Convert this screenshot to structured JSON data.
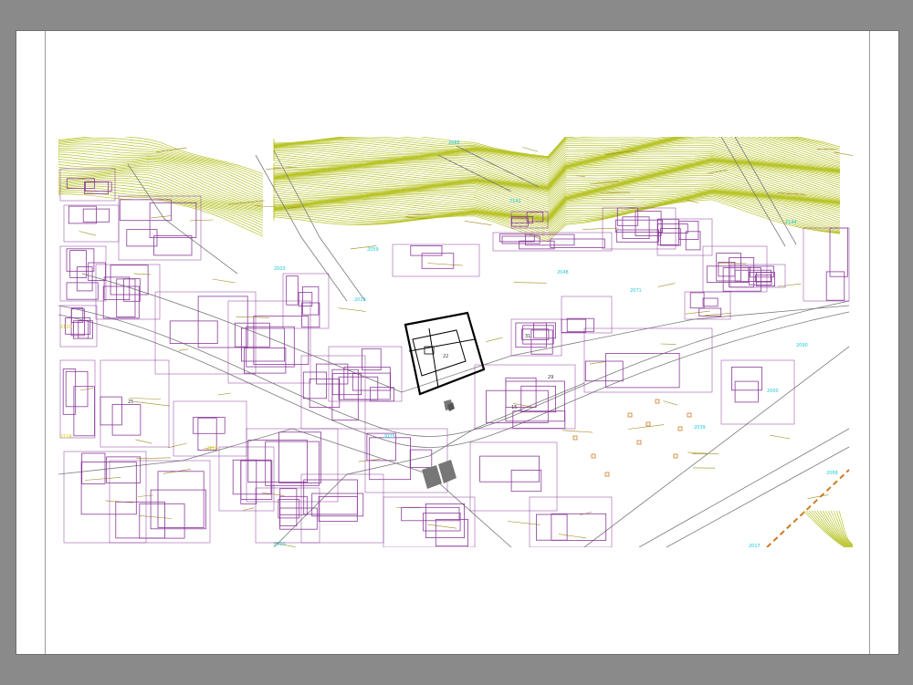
{
  "viewer": {
    "background_color": "#8a8a8a",
    "sheet_color": "#ffffff"
  },
  "plan": {
    "colors": {
      "contours": "#b8c428",
      "buildings": "#8a3a9a",
      "parcels": "#a08a20",
      "annotations": "#1ec8d8",
      "streets": "#7a7a7a",
      "project_site": "#000000",
      "railway": "#d07a20"
    },
    "icons": [
      "site-plan-icon"
    ],
    "labels": {
      "top_center": "2085",
      "park_a": "2141",
      "park_b": "2059",
      "street_a": "2003",
      "street_b": "2013",
      "street_c": "2048",
      "street_d": "2071",
      "street_e": "2039",
      "street_f": "2090",
      "square": "2025",
      "river": "2000",
      "west_a": "2120",
      "west_b": "2114",
      "west_c": "2106",
      "east_a": "2144",
      "east_b": "2068",
      "south_a": "2031",
      "south_b": "2017",
      "south_c": "2010",
      "block_a": "25",
      "block_b": "15",
      "block_c": "31",
      "church": "29",
      "site": "22"
    }
  }
}
